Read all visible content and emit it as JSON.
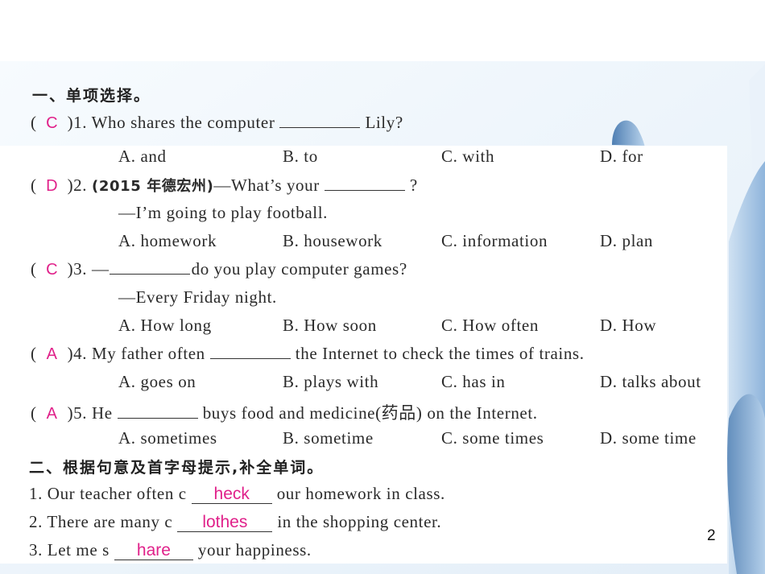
{
  "page_number": "2",
  "colors": {
    "answer": "#e0218a",
    "text": "#2a2a2a",
    "decor_blue": "#6f9ccc"
  },
  "section1": {
    "heading": "一、单项选择。",
    "questions": [
      {
        "answer": "C",
        "number": ")1.",
        "prefix": "Who shares the computer",
        "suffix": "Lily?",
        "options": [
          "A. and",
          "B. to",
          "C. with",
          "D. for"
        ]
      },
      {
        "answer": "D",
        "number": ")2.",
        "source": "(2015 年德宏州)",
        "prefix": "—What’s your",
        "suffix": "?",
        "reply": "—I’m going to play football.",
        "options": [
          "A. homework",
          "B. housework",
          "C. information",
          "D. plan"
        ]
      },
      {
        "answer": "C",
        "number": ")3.",
        "prefix": "—",
        "suffix": "do you play computer games?",
        "reply": "—Every Friday night.",
        "options": [
          "A. How long",
          "B. How soon",
          "C. How often",
          "D. How"
        ]
      },
      {
        "answer": "A",
        "number": ")4.",
        "prefix": "My father often",
        "suffix": "the Internet to check the times of trains.",
        "options": [
          "A. goes on",
          "B. plays with",
          "C. has in",
          "D. talks about"
        ]
      },
      {
        "answer": "A",
        "number": ")5.",
        "prefix": "He",
        "suffix": "buys food and medicine(药品) on the Internet.",
        "options": [
          "A. sometimes",
          "B. sometime",
          "C. some times",
          "D. some time"
        ]
      }
    ]
  },
  "section2": {
    "heading": "二、根据句意及首字母提示,补全单词。",
    "items": [
      {
        "prefix": "1. Our teacher often c",
        "fill": "heck",
        "suffix": "our homework in class."
      },
      {
        "prefix": "2. There are many c",
        "fill": "lothes",
        "suffix": "in the shopping center."
      },
      {
        "prefix": "3. Let me s",
        "fill": "hare",
        "suffix": "your happiness."
      }
    ]
  }
}
